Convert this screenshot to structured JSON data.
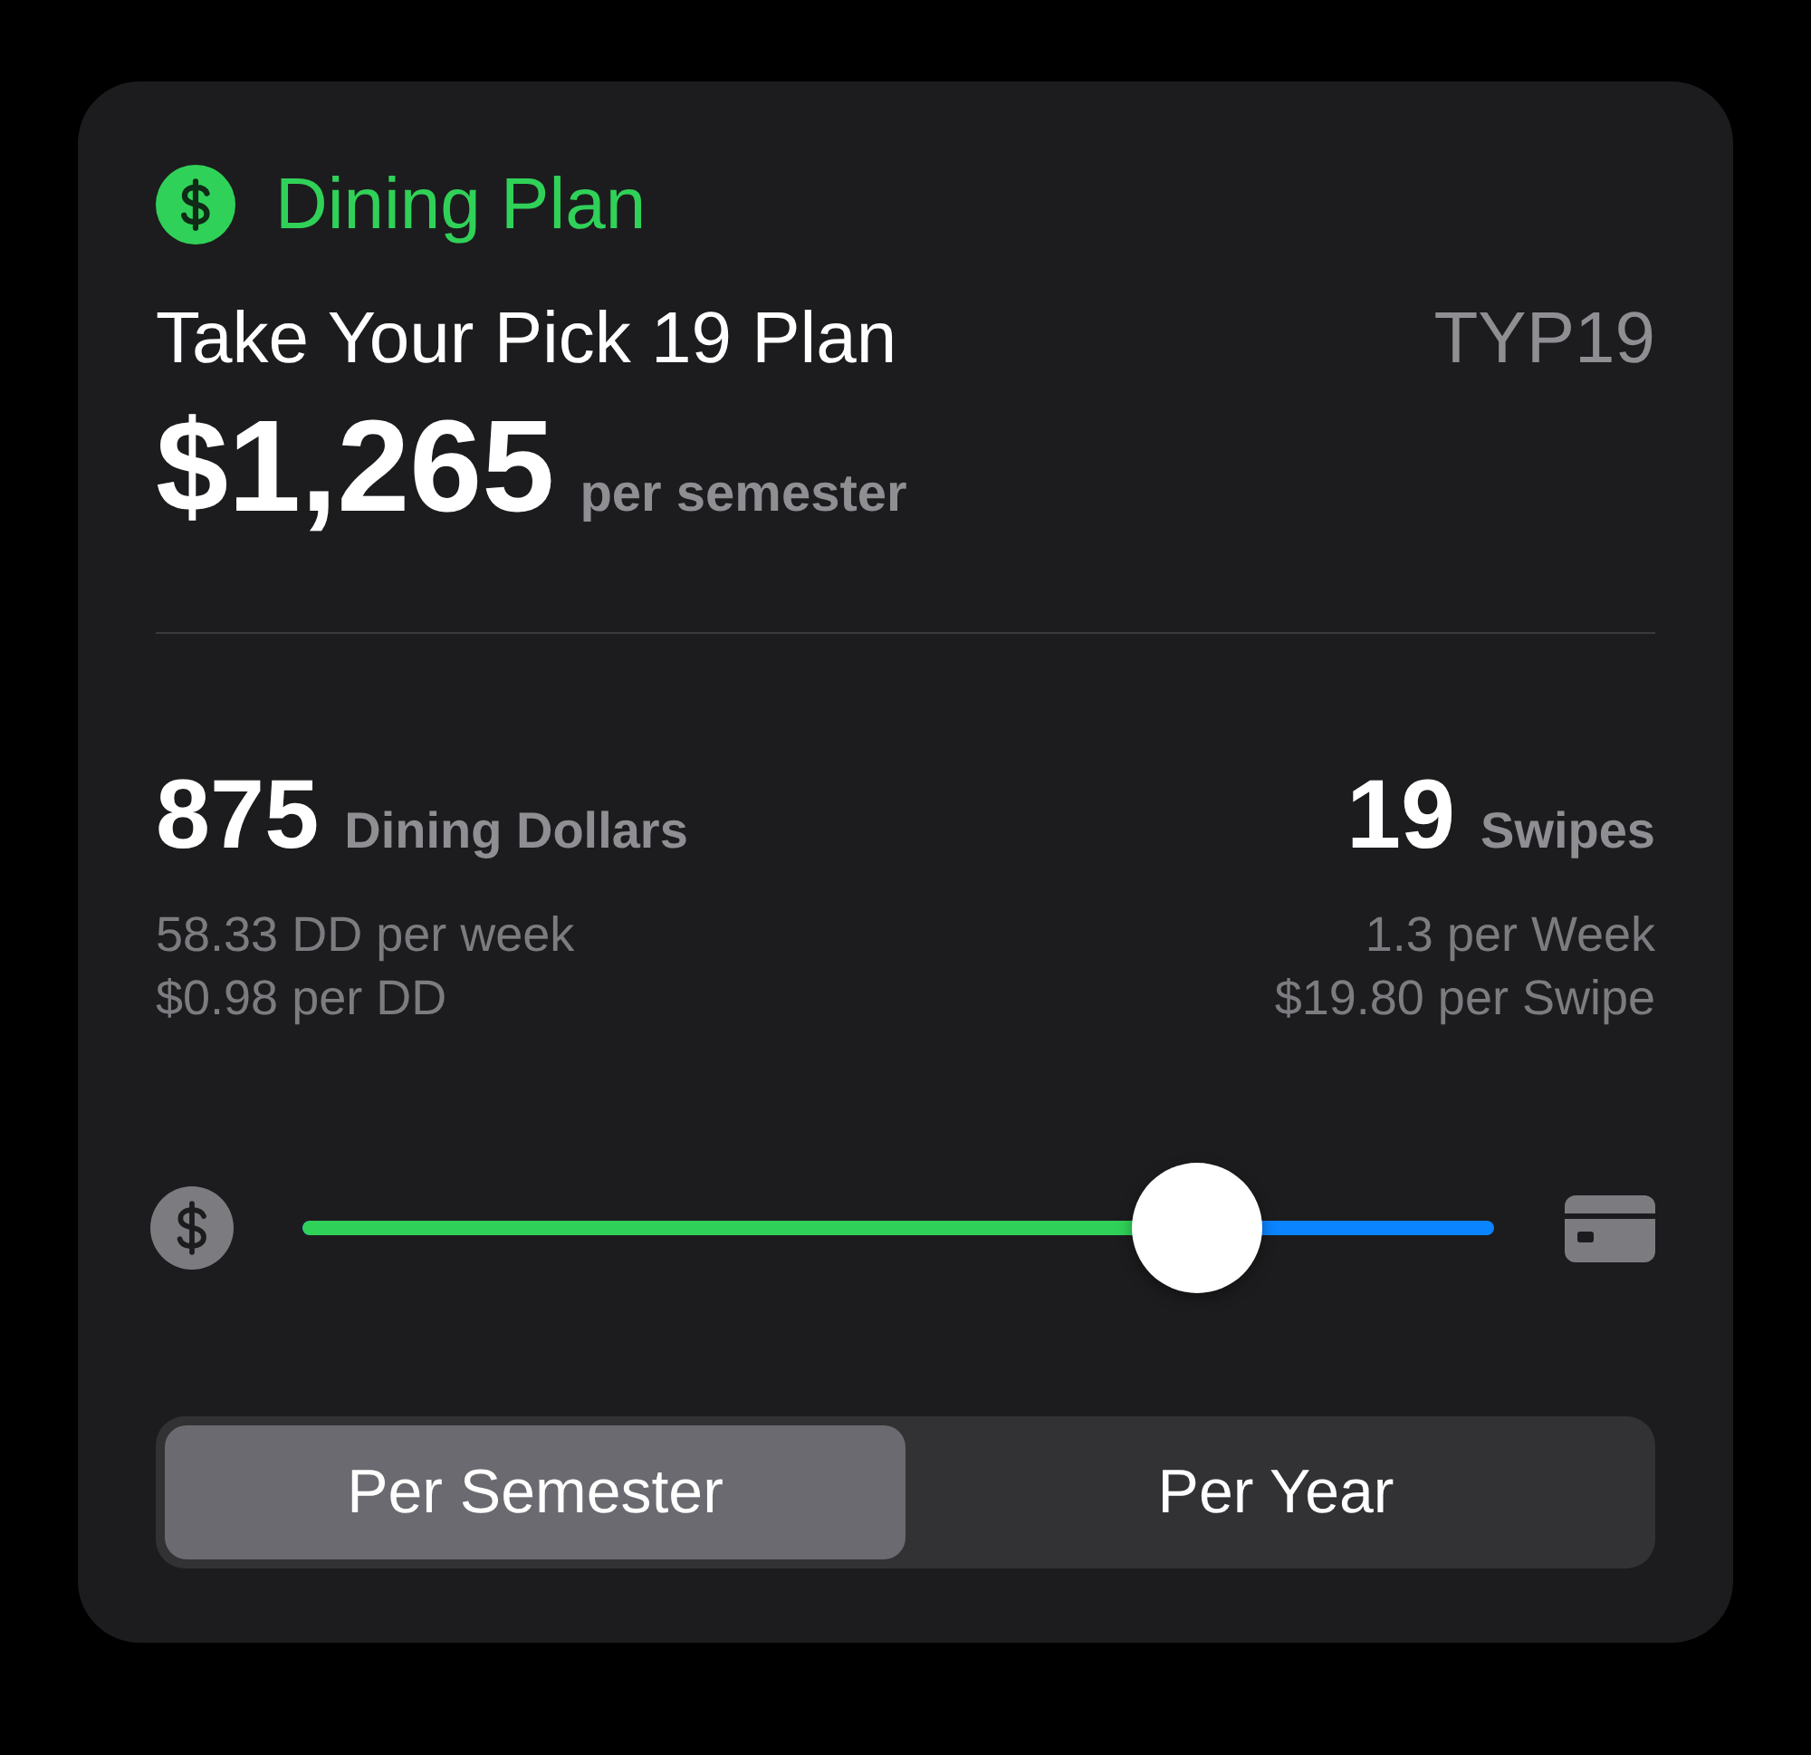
{
  "header": {
    "title": "Dining Plan"
  },
  "plan": {
    "name": "Take Your Pick 19 Plan",
    "code": "TYP19",
    "price": "$1,265",
    "price_unit": "per semester"
  },
  "stats": [
    {
      "value": "875",
      "unit": "Dining Dollars",
      "details": [
        "58.33 DD per week",
        "$0.98 per DD"
      ]
    },
    {
      "value": "19",
      "unit": "Swipes",
      "details": [
        "1.3 per Week",
        "$19.80 per Swipe"
      ]
    }
  ],
  "slider": {
    "level": 0.75
  },
  "segments": [
    {
      "label": "Per Semester",
      "selected": true
    },
    {
      "label": "Per Year",
      "selected": false
    }
  ]
}
